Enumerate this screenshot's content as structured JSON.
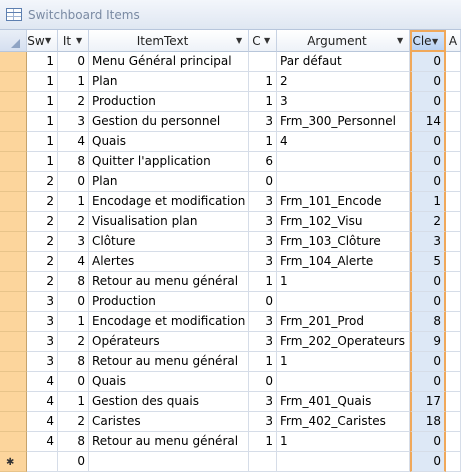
{
  "window": {
    "title": "Switchboard Items"
  },
  "columns": [
    {
      "label": "Sw",
      "has_arrow": true
    },
    {
      "label": "It",
      "has_arrow": true
    },
    {
      "label": "ItemText",
      "has_arrow": true
    },
    {
      "label": "C",
      "has_arrow": true
    },
    {
      "label": "Argument",
      "has_arrow": true
    },
    {
      "label": "Cle",
      "has_arrow": true
    },
    {
      "label": "A",
      "has_arrow": false
    }
  ],
  "rows": [
    [
      "1",
      "0",
      "Menu Général principal",
      "",
      "Par défaut",
      "0"
    ],
    [
      "1",
      "1",
      "Plan",
      "1",
      "2",
      "0"
    ],
    [
      "1",
      "2",
      "Production",
      "1",
      "3",
      "0"
    ],
    [
      "1",
      "3",
      "Gestion du personnel",
      "3",
      "Frm_300_Personnel",
      "14"
    ],
    [
      "1",
      "4",
      "Quais",
      "1",
      "4",
      "0"
    ],
    [
      "1",
      "8",
      "Quitter l'application",
      "6",
      "",
      "0"
    ],
    [
      "2",
      "0",
      "Plan",
      "0",
      "",
      "0"
    ],
    [
      "2",
      "1",
      "Encodage et modification",
      "3",
      "Frm_101_Encode",
      "1"
    ],
    [
      "2",
      "2",
      "Visualisation plan",
      "3",
      "Frm_102_Visu",
      "2"
    ],
    [
      "2",
      "3",
      "Clôture",
      "3",
      "Frm_103_Clôture",
      "3"
    ],
    [
      "2",
      "4",
      "Alertes",
      "3",
      "Frm_104_Alerte",
      "5"
    ],
    [
      "2",
      "8",
      "Retour au menu général",
      "1",
      "1",
      "0"
    ],
    [
      "3",
      "0",
      "Production",
      "0",
      "",
      "0"
    ],
    [
      "3",
      "1",
      "Encodage et modification",
      "3",
      "Frm_201_Prod",
      "8"
    ],
    [
      "3",
      "2",
      "Opérateurs",
      "3",
      "Frm_202_Operateurs",
      "9"
    ],
    [
      "3",
      "8",
      "Retour au menu général",
      "1",
      "1",
      "0"
    ],
    [
      "4",
      "0",
      "Quais",
      "0",
      "",
      "0"
    ],
    [
      "4",
      "1",
      "Gestion des quais",
      "3",
      "Frm_401_Quais",
      "17"
    ],
    [
      "4",
      "2",
      "Caristes",
      "3",
      "Frm_402_Caristes",
      "18"
    ],
    [
      "4",
      "8",
      "Retour au menu général",
      "1",
      "1",
      "0"
    ]
  ],
  "new_row": {
    "marker": "✱",
    "values": [
      "",
      "0",
      "",
      "",
      "",
      "0"
    ]
  },
  "colors": {
    "selected_column_border": "#f0a85a",
    "row_selector": "#fcd59c"
  }
}
